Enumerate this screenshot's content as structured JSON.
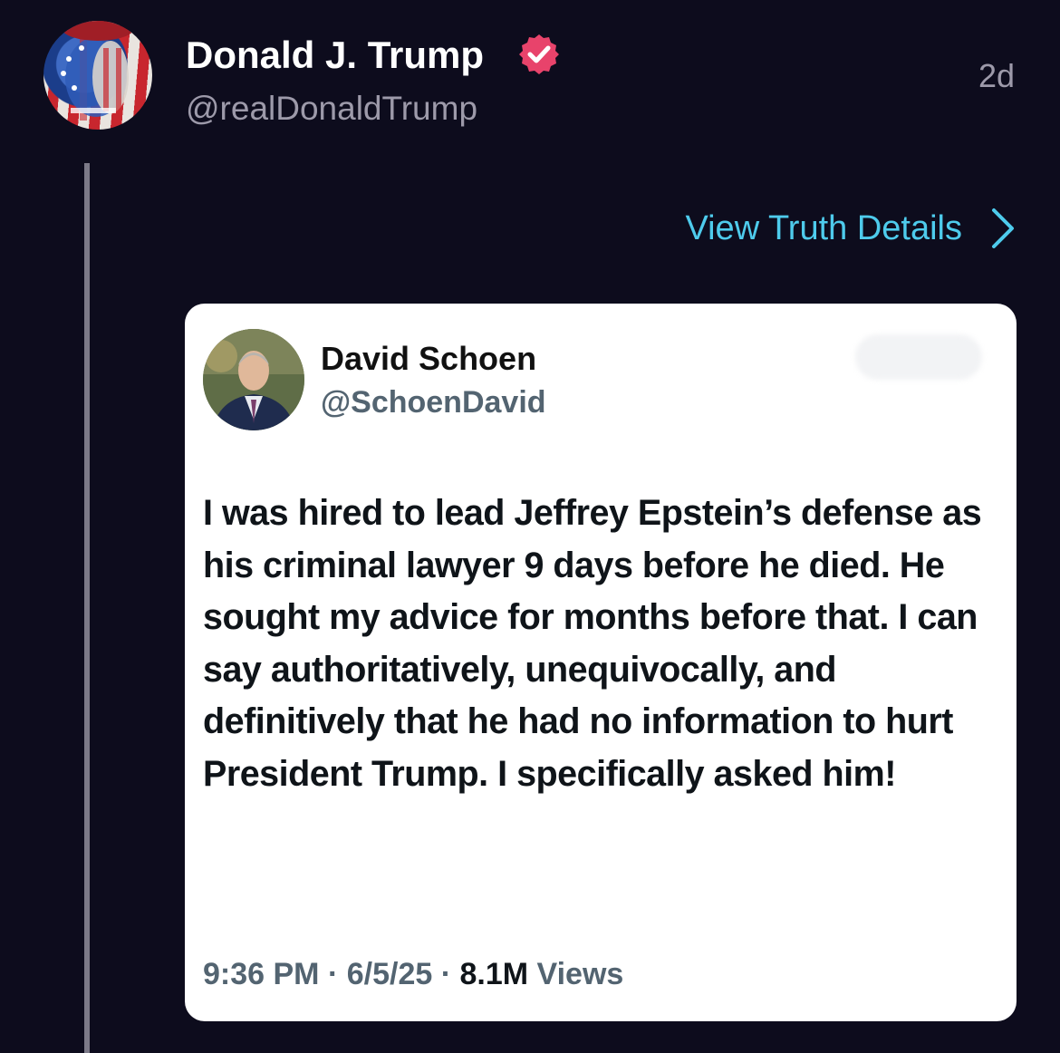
{
  "post": {
    "author_name": "Donald J. Trump",
    "author_handle": "@realDonaldTrump",
    "timestamp": "2d",
    "view_details_label": "View Truth Details"
  },
  "quoted": {
    "name": "David Schoen",
    "handle": "@SchoenDavid",
    "body": "I was hired to lead Jeffrey Epstein’s defense as his criminal lawyer 9 days before he died.  He sought my advice for months before that.  I can say authoritatively, unequivocally, and definitively that he had no information to hurt President Trump.  I specifically asked him!",
    "time": "9:36 PM",
    "date": "6/5/25",
    "views_count": "8.1M",
    "views_label": "Views"
  },
  "colors": {
    "background": "#0d0c1d",
    "link": "#4ecbec",
    "verified_badge": "#e8436b",
    "muted_text": "#9d9aaa"
  },
  "icons": {
    "verified": "verified-badge-icon",
    "chevron": "chevron-right-icon"
  }
}
